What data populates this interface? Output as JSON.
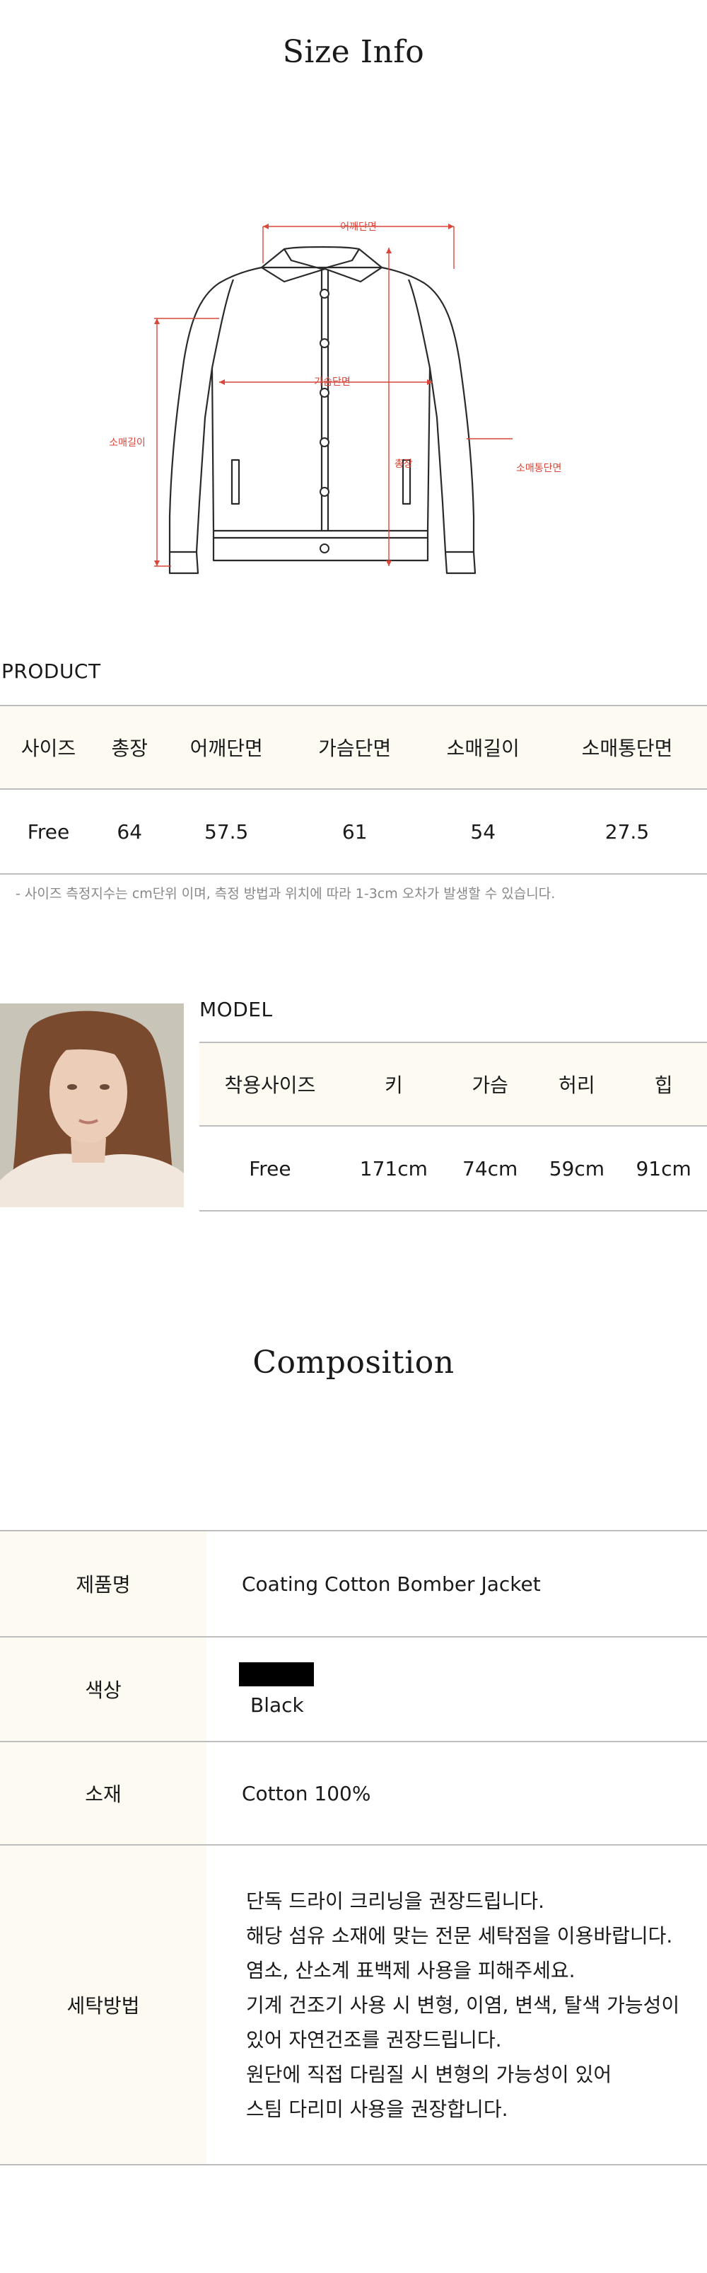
{
  "size_info": {
    "title": "Size Info",
    "diagram_labels": {
      "shoulder": "어깨단면",
      "chest": "가슴단면",
      "sleeve_length": "소매길이",
      "total_length": "총장",
      "sleeve_width": "소매통단면"
    }
  },
  "product": {
    "label": "PRODUCT",
    "headers": [
      "사이즈",
      "총장",
      "어깨단면",
      "가슴단면",
      "소매길이",
      "소매통단면"
    ],
    "rows": [
      [
        "Free",
        "64",
        "57.5",
        "61",
        "54",
        "27.5"
      ]
    ],
    "note": "-  사이즈 측정지수는 cm단위 이며, 측정 방법과 위치에 따라 1-3cm 오차가 발생할 수 있습니다."
  },
  "model": {
    "label": "MODEL",
    "headers": [
      "착용사이즈",
      "키",
      "가슴",
      "허리",
      "힙"
    ],
    "rows": [
      [
        "Free",
        "171cm",
        "74cm",
        "59cm",
        "91cm"
      ]
    ]
  },
  "composition": {
    "title": "Composition",
    "rows": {
      "name_label": "제품명",
      "name_value": "Coating Cotton Bomber Jacket",
      "color_label": "색상",
      "color_value": "Black",
      "color_swatch": "#000000",
      "material_label": "소재",
      "material_value": "Cotton 100%",
      "care_label": "세탁방법",
      "care_lines": [
        "단독 드라이 크리닝을 권장드립니다.",
        "해당 섬유 소재에 맞는 전문 세탁점을 이용바랍니다.",
        "염소, 산소계 표백제 사용을 피해주세요.",
        "기계 건조기 사용 시 변형, 이염, 변색, 탈색 가능성이",
        "있어 자연건조를 권장드립니다.",
        "원단에 직접 다림질 시 변형의 가능성이 있어",
        "스팀 다리미 사용을 권장합니다."
      ]
    }
  },
  "colors": {
    "accent_red": "#d9473b",
    "line": "#bdbdbd",
    "header_bg": "#fdfbf1"
  }
}
